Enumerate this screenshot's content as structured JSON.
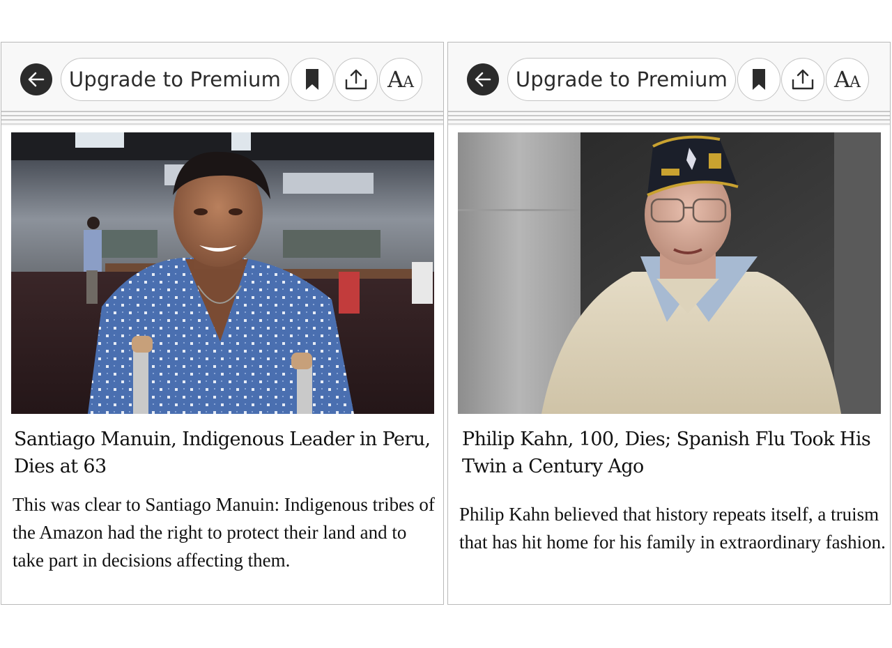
{
  "panels": [
    {
      "toolbar": {
        "back_icon": "arrow-left-icon",
        "premium_label": "Upgrade to Premium",
        "bookmark_icon": "bookmark-icon",
        "share_icon": "share-icon",
        "font_size_label_big": "A",
        "font_size_label_small": "A"
      },
      "article": {
        "image_icon": "photo-man-with-crutches",
        "headline": "Santiago Manuin, Indigenous Leader in Peru, Dies at 63",
        "summary": "This was clear to Santiago Manuin: Indigenous tribes of the Amazon had the right to protect their land and to take part in decisions affecting them."
      }
    },
    {
      "toolbar": {
        "back_icon": "arrow-left-icon",
        "premium_label": "Upgrade to Premium",
        "bookmark_icon": "bookmark-icon",
        "share_icon": "share-icon",
        "font_size_label_big": "A",
        "font_size_label_small": "A"
      },
      "article": {
        "image_icon": "photo-elderly-veteran",
        "headline": "Philip Kahn, 100, Dies; Spanish Flu Took His Twin a Century Ago",
        "summary": "Philip Kahn believed that history repeats itself, a truism that has hit home for his family in extraordinary fashion."
      }
    }
  ],
  "colors": {
    "toolbar_bg": "#f8f8f8",
    "button_border": "#c4c4c4",
    "icon_dark": "#2b2b2b",
    "text": "#111111"
  }
}
